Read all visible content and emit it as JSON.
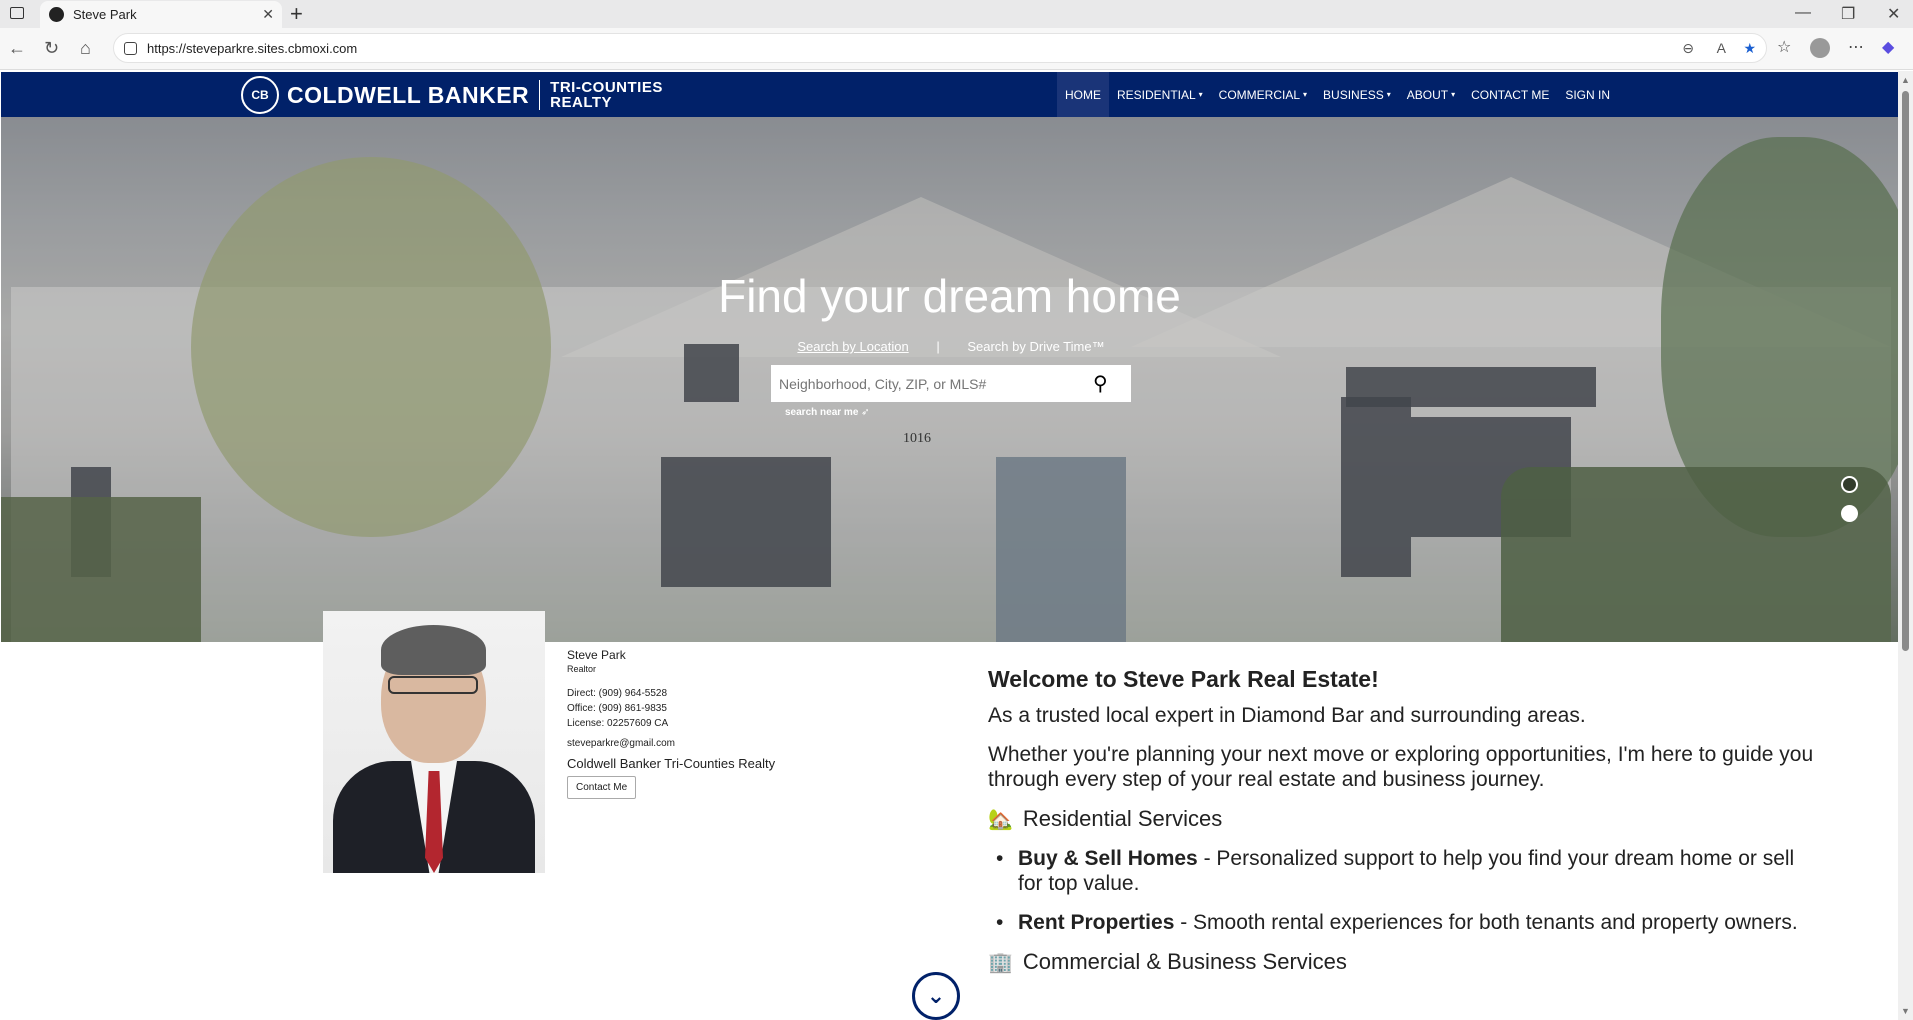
{
  "browser": {
    "tab_title": "Steve Park",
    "url": "https://steveparkre.sites.cbmoxi.com"
  },
  "site": {
    "logo_text": "COLDWELL BANKER",
    "logo_sub1": "TRI-COUNTIES",
    "logo_sub2": "REALTY",
    "seal": "CB",
    "menu": [
      {
        "label": "HOME",
        "caret": false
      },
      {
        "label": "RESIDENTIAL",
        "caret": true
      },
      {
        "label": "COMMERCIAL",
        "caret": true
      },
      {
        "label": "BUSINESS",
        "caret": true
      },
      {
        "label": "ABOUT",
        "caret": true
      },
      {
        "label": "CONTACT ME",
        "caret": false
      },
      {
        "label": "SIGN IN",
        "caret": false
      }
    ]
  },
  "hero": {
    "headline": "Find your dream home",
    "tab_location": "Search by Location",
    "tab_divider": "|",
    "tab_drive": "Search by Drive Time™",
    "search_placeholder": "Neighborhood, City, ZIP, or MLS#",
    "near_me": "search near me ➶",
    "house_number": "1016"
  },
  "agent": {
    "name": "Steve Park",
    "title": "Realtor",
    "direct": "Direct: (909) 964-5528",
    "office": "Office: (909) 861-9835",
    "license": "License: 02257609 CA",
    "email": "steveparkre@gmail.com",
    "company": "Coldwell Banker Tri-Counties Realty",
    "contact_button": "Contact Me"
  },
  "welcome": {
    "heading": "Welcome to Steve Park Real Estate!",
    "intro": "As a trusted local expert in Diamond Bar and surrounding areas.",
    "para": "Whether you're planning your next move or exploring opportunities, I'm here to guide you through every step of your real estate and business journey.",
    "residential_heading": "Residential Services",
    "residential_icon": "🏡",
    "items": [
      {
        "bold": "Buy & Sell Homes",
        "text": " - Personalized support to help you find your dream home or sell for top value."
      },
      {
        "bold": "Rent Properties",
        "text": " - Smooth rental experiences for both tenants and property owners."
      }
    ],
    "commercial_heading": "Commercial & Business Services",
    "commercial_icon": "🏢"
  }
}
